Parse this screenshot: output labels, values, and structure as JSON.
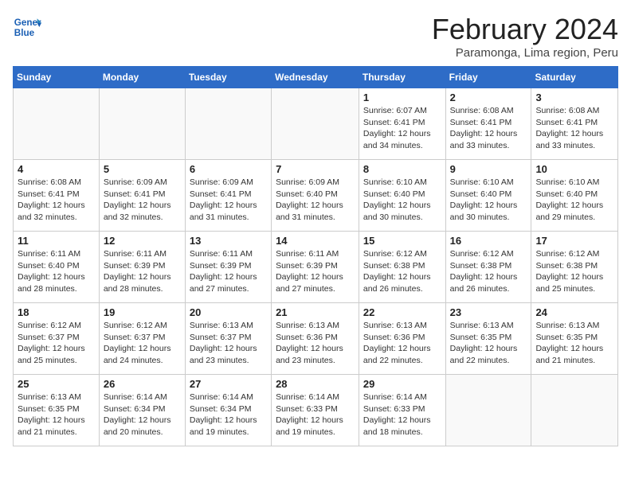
{
  "header": {
    "logo_line1": "General",
    "logo_line2": "Blue",
    "month_title": "February 2024",
    "location": "Paramonga, Lima region, Peru"
  },
  "weekdays": [
    "Sunday",
    "Monday",
    "Tuesday",
    "Wednesday",
    "Thursday",
    "Friday",
    "Saturday"
  ],
  "weeks": [
    [
      {
        "day": "",
        "info": ""
      },
      {
        "day": "",
        "info": ""
      },
      {
        "day": "",
        "info": ""
      },
      {
        "day": "",
        "info": ""
      },
      {
        "day": "1",
        "info": "Sunrise: 6:07 AM\nSunset: 6:41 PM\nDaylight: 12 hours\nand 34 minutes."
      },
      {
        "day": "2",
        "info": "Sunrise: 6:08 AM\nSunset: 6:41 PM\nDaylight: 12 hours\nand 33 minutes."
      },
      {
        "day": "3",
        "info": "Sunrise: 6:08 AM\nSunset: 6:41 PM\nDaylight: 12 hours\nand 33 minutes."
      }
    ],
    [
      {
        "day": "4",
        "info": "Sunrise: 6:08 AM\nSunset: 6:41 PM\nDaylight: 12 hours\nand 32 minutes."
      },
      {
        "day": "5",
        "info": "Sunrise: 6:09 AM\nSunset: 6:41 PM\nDaylight: 12 hours\nand 32 minutes."
      },
      {
        "day": "6",
        "info": "Sunrise: 6:09 AM\nSunset: 6:41 PM\nDaylight: 12 hours\nand 31 minutes."
      },
      {
        "day": "7",
        "info": "Sunrise: 6:09 AM\nSunset: 6:40 PM\nDaylight: 12 hours\nand 31 minutes."
      },
      {
        "day": "8",
        "info": "Sunrise: 6:10 AM\nSunset: 6:40 PM\nDaylight: 12 hours\nand 30 minutes."
      },
      {
        "day": "9",
        "info": "Sunrise: 6:10 AM\nSunset: 6:40 PM\nDaylight: 12 hours\nand 30 minutes."
      },
      {
        "day": "10",
        "info": "Sunrise: 6:10 AM\nSunset: 6:40 PM\nDaylight: 12 hours\nand 29 minutes."
      }
    ],
    [
      {
        "day": "11",
        "info": "Sunrise: 6:11 AM\nSunset: 6:40 PM\nDaylight: 12 hours\nand 28 minutes."
      },
      {
        "day": "12",
        "info": "Sunrise: 6:11 AM\nSunset: 6:39 PM\nDaylight: 12 hours\nand 28 minutes."
      },
      {
        "day": "13",
        "info": "Sunrise: 6:11 AM\nSunset: 6:39 PM\nDaylight: 12 hours\nand 27 minutes."
      },
      {
        "day": "14",
        "info": "Sunrise: 6:11 AM\nSunset: 6:39 PM\nDaylight: 12 hours\nand 27 minutes."
      },
      {
        "day": "15",
        "info": "Sunrise: 6:12 AM\nSunset: 6:38 PM\nDaylight: 12 hours\nand 26 minutes."
      },
      {
        "day": "16",
        "info": "Sunrise: 6:12 AM\nSunset: 6:38 PM\nDaylight: 12 hours\nand 26 minutes."
      },
      {
        "day": "17",
        "info": "Sunrise: 6:12 AM\nSunset: 6:38 PM\nDaylight: 12 hours\nand 25 minutes."
      }
    ],
    [
      {
        "day": "18",
        "info": "Sunrise: 6:12 AM\nSunset: 6:37 PM\nDaylight: 12 hours\nand 25 minutes."
      },
      {
        "day": "19",
        "info": "Sunrise: 6:12 AM\nSunset: 6:37 PM\nDaylight: 12 hours\nand 24 minutes."
      },
      {
        "day": "20",
        "info": "Sunrise: 6:13 AM\nSunset: 6:37 PM\nDaylight: 12 hours\nand 23 minutes."
      },
      {
        "day": "21",
        "info": "Sunrise: 6:13 AM\nSunset: 6:36 PM\nDaylight: 12 hours\nand 23 minutes."
      },
      {
        "day": "22",
        "info": "Sunrise: 6:13 AM\nSunset: 6:36 PM\nDaylight: 12 hours\nand 22 minutes."
      },
      {
        "day": "23",
        "info": "Sunrise: 6:13 AM\nSunset: 6:35 PM\nDaylight: 12 hours\nand 22 minutes."
      },
      {
        "day": "24",
        "info": "Sunrise: 6:13 AM\nSunset: 6:35 PM\nDaylight: 12 hours\nand 21 minutes."
      }
    ],
    [
      {
        "day": "25",
        "info": "Sunrise: 6:13 AM\nSunset: 6:35 PM\nDaylight: 12 hours\nand 21 minutes."
      },
      {
        "day": "26",
        "info": "Sunrise: 6:14 AM\nSunset: 6:34 PM\nDaylight: 12 hours\nand 20 minutes."
      },
      {
        "day": "27",
        "info": "Sunrise: 6:14 AM\nSunset: 6:34 PM\nDaylight: 12 hours\nand 19 minutes."
      },
      {
        "day": "28",
        "info": "Sunrise: 6:14 AM\nSunset: 6:33 PM\nDaylight: 12 hours\nand 19 minutes."
      },
      {
        "day": "29",
        "info": "Sunrise: 6:14 AM\nSunset: 6:33 PM\nDaylight: 12 hours\nand 18 minutes."
      },
      {
        "day": "",
        "info": ""
      },
      {
        "day": "",
        "info": ""
      }
    ]
  ]
}
